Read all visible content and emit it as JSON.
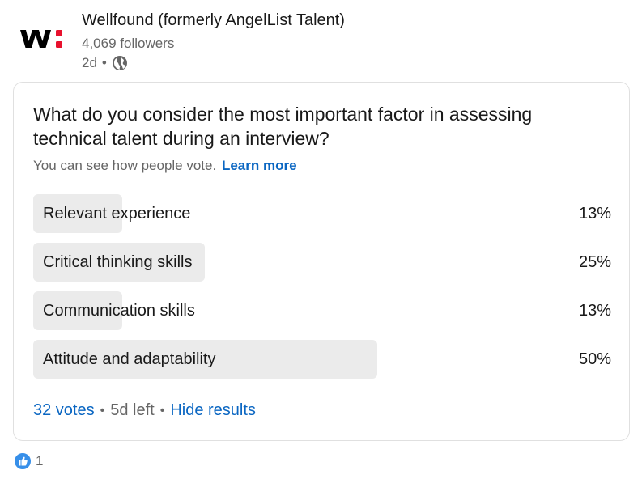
{
  "post": {
    "company_name": "Wellfound (formerly AngelList Talent)",
    "followers": "4,069 followers",
    "time_ago": "2d",
    "meta_separator": "•",
    "visibility_icon": "globe-icon",
    "logo_icon": "wellfound-logo"
  },
  "poll": {
    "question": "What do you consider the most important factor in assessing technical talent during an interview?",
    "vote_note": "You can see how people vote.",
    "learn_more": "Learn more",
    "options": [
      {
        "label": "Relevant experience",
        "percent": "13%",
        "fraction": 0.13
      },
      {
        "label": "Critical thinking skills",
        "percent": "25%",
        "fraction": 0.25
      },
      {
        "label": "Communication skills",
        "percent": "13%",
        "fraction": 0.13
      },
      {
        "label": "Attitude and adaptability",
        "percent": "50%",
        "fraction": 0.5
      }
    ],
    "votes": "32 votes",
    "time_left": "5d left",
    "separator": "•",
    "hide_results": "Hide results"
  },
  "reactions": {
    "icon": "like-icon",
    "count": "1"
  },
  "colors": {
    "link": "#0a66c2",
    "bar_fill": "#ebebeb",
    "logo_accent": "#e8112d"
  }
}
